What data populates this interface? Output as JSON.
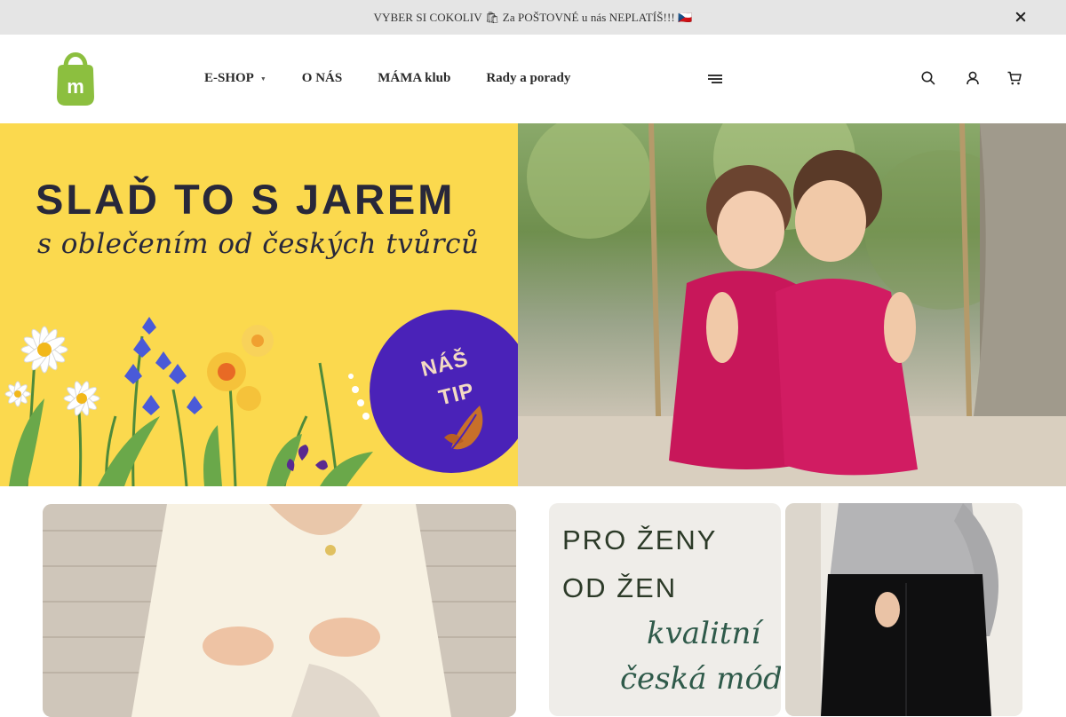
{
  "announcement": {
    "text": "VYBER SI COKOLIV 🛍 Za POŠTOVNÉ u nás NEPLATÍŠ!!! 🇨🇿"
  },
  "header": {
    "nav": [
      {
        "label": "E-SHOP",
        "has_dropdown": true
      },
      {
        "label": "O NÁS"
      },
      {
        "label": "MÁMA klub"
      },
      {
        "label": "Rady a porady"
      }
    ],
    "icons": [
      "menu-icon",
      "search-icon",
      "user-icon",
      "cart-icon"
    ],
    "logo_color": "#8cbf3f"
  },
  "hero": {
    "title": "SLAĎ TO S JAREM",
    "subtitle": "s oblečením od českých tvůrců",
    "badge_line1": "NÁŠ",
    "badge_line2": "TIP",
    "bg_color": "#fbd94e",
    "badge_color": "#4a22b8"
  },
  "cards": {
    "promo": {
      "line1": "PRO ŽENY",
      "line2": "OD ŽEN",
      "line3": "kvalitní",
      "line4": "česká móda"
    }
  }
}
